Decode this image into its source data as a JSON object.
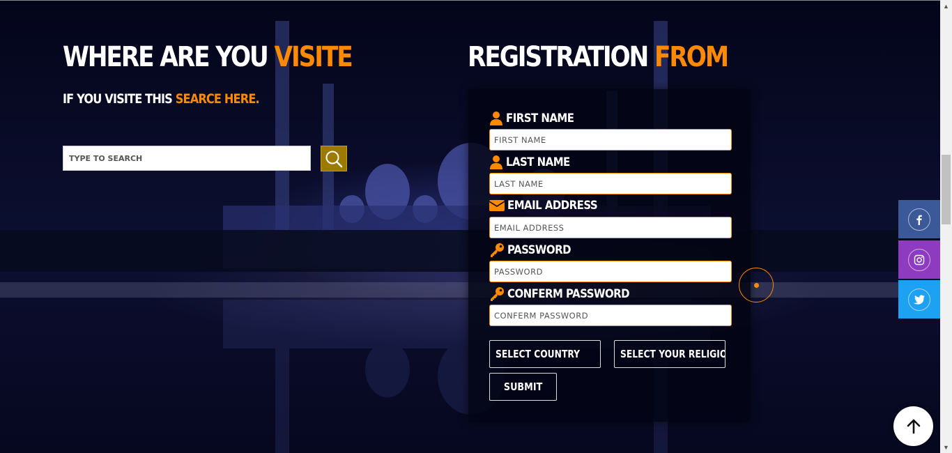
{
  "left_section": {
    "title_white": "WHERE ARE YOU",
    "title_orange": "VISITE",
    "subtitle_white": "IF YOU VISITE THIS",
    "subtitle_orange": "SEARCE HERE.",
    "search": {
      "placeholder": "TYPE TO SEARCH",
      "button_icon": "search-icon"
    }
  },
  "registration": {
    "title_white": "REGISTRATION",
    "title_orange": "FROM",
    "fields": [
      {
        "label": "FIRST NAME",
        "placeholder": "FIRST NAME",
        "icon": "user-icon"
      },
      {
        "label": "LAST NAME",
        "placeholder": "LAST NAME",
        "icon": "user-icon"
      },
      {
        "label": "EMAIL ADDRESS",
        "placeholder": "EMAIL ADDRESS",
        "icon": "envelope-icon"
      },
      {
        "label": "PASSWORD",
        "placeholder": "PASSWORD",
        "icon": "key-icon"
      },
      {
        "label": "CONFERM PASSWORD",
        "placeholder": "CONFERM PASSWORD",
        "icon": "key-icon"
      }
    ],
    "select_country": "SELECT COUNTRY",
    "select_religion": "SELECT YOUR RELIGIO",
    "submit_label": "SUBMIT"
  },
  "social": [
    {
      "name": "facebook",
      "color": "#3b5998",
      "icon": "facebook-icon"
    },
    {
      "name": "instagram",
      "color": "#8e3bc0",
      "icon": "instagram-icon"
    },
    {
      "name": "twitter",
      "color": "#1da1f2",
      "icon": "twitter-icon"
    }
  ],
  "colors": {
    "accent": "#ff8a00",
    "search_button": "#9c7a00"
  },
  "back_to_top_icon": "arrow-up-icon"
}
